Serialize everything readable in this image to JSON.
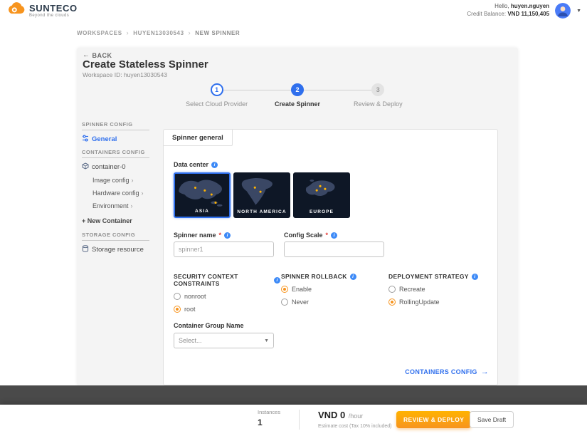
{
  "header": {
    "brand_name": "SUNTECO",
    "brand_tagline": "Beyond the clouds",
    "greeting_prefix": "Hello,",
    "user_name": "huyen.nguyen",
    "credit_label": "Credit Balance:",
    "credit_value": "VND 11,150,405"
  },
  "breadcrumb": {
    "items": [
      "WORKSPACES",
      "HUYEN13030543",
      "NEW SPINNER"
    ]
  },
  "page": {
    "back_label": "BACK",
    "title": "Create Stateless Spinner",
    "workspace": "Workspace ID: huyen13030543"
  },
  "stepper": {
    "steps": [
      {
        "num": "1",
        "label": "Select Cloud Provider",
        "state": "done"
      },
      {
        "num": "2",
        "label": "Create Spinner",
        "state": "active"
      },
      {
        "num": "3",
        "label": "Review & Deploy",
        "state": "todo"
      }
    ]
  },
  "sidebar": {
    "spinner_config_header": "SPINNER CONFIG",
    "general_label": "General",
    "containers_config_header": "CONTAINERS CONFIG",
    "container_label": "container-0",
    "sub_items": [
      "Image config",
      "Hardware config",
      "Environment"
    ],
    "new_container_label": "+ New Container",
    "storage_config_header": "STORAGE CONFIG",
    "storage_resource_label": "Storage resource"
  },
  "form": {
    "card_title": "Spinner general",
    "data_center_label": "Data center",
    "required_marker": "*",
    "regions": [
      {
        "label": "ASIA",
        "selected": true
      },
      {
        "label": "NORTH AMERICA",
        "selected": false
      },
      {
        "label": "EUROPE",
        "selected": false
      }
    ],
    "spinner_name_label": "Spinner name",
    "spinner_name_placeholder": "spinner1",
    "config_scale_label": "Config Scale",
    "config_scale_value": "",
    "security_title": "SECURITY CONTEXT CONSTRAINTS",
    "security_options": [
      {
        "label": "nonroot",
        "checked": false
      },
      {
        "label": "root",
        "checked": true
      }
    ],
    "rollback_title": "SPINNER ROLLBACK",
    "rollback_options": [
      {
        "label": "Enable",
        "checked": true
      },
      {
        "label": "Never",
        "checked": false
      }
    ],
    "strategy_title": "DEPLOYMENT STRATEGY",
    "strategy_options": [
      {
        "label": "Recreate",
        "checked": false
      },
      {
        "label": "RollingUpdate",
        "checked": true
      }
    ],
    "container_group_label": "Container Group Name",
    "container_group_placeholder": "Select...",
    "containers_config_link": "CONTAINERS CONFIG"
  },
  "footer": {
    "instances_label": "Instances",
    "instances_value": "1",
    "price_value": "VND 0",
    "price_unit": "/hour",
    "price_note": "Estimate cost (Tax 10% included)",
    "review_deploy_label": "REVIEW & DEPLOY",
    "save_draft_label": "Save Draft"
  },
  "icons": {
    "back_arrow": "←",
    "separator": "›",
    "chevron_right": "›",
    "caret_down": "▼",
    "select_caret": "▼",
    "link_arrow": "→"
  },
  "colors": {
    "brand_orange": "#f7941e",
    "accent_blue": "#2f6fed",
    "radio_selected": "#f7941e",
    "region_card_bg": "#0e1726",
    "map_dot": "#ffb300",
    "dark_strip": "#4a4a4a"
  }
}
